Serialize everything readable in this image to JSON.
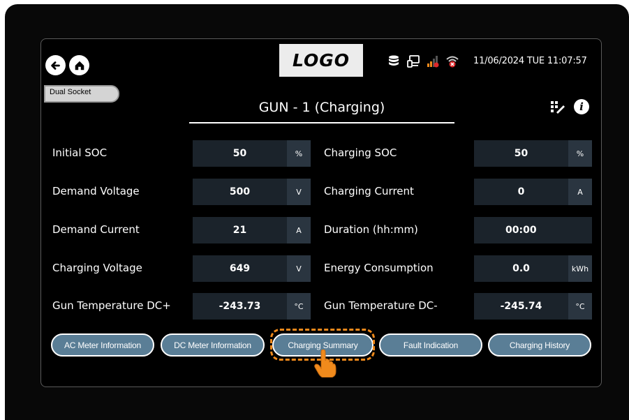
{
  "header": {
    "logo_text": "LOGO",
    "datetime": "11/06/2024 TUE 11:07:57",
    "icons": [
      "back-arrow-icon",
      "home-icon",
      "database-icon",
      "network-icon",
      "signal-bars-icon",
      "wifi-error-icon"
    ]
  },
  "mode_badge": "Dual Socket",
  "title": "GUN - 1 (Charging)",
  "left_fields": [
    {
      "label": "Initial SOC",
      "value": "50",
      "unit": "%"
    },
    {
      "label": "Demand Voltage",
      "value": "500",
      "unit": "V"
    },
    {
      "label": "Demand Current",
      "value": "21",
      "unit": "A"
    },
    {
      "label": "Charging Voltage",
      "value": "649",
      "unit": "V"
    },
    {
      "label": "Gun Temperature DC+",
      "value": "-243.73",
      "unit": "°C"
    }
  ],
  "right_fields": [
    {
      "label": "Charging SOC",
      "value": "50",
      "unit": "%"
    },
    {
      "label": "Charging Current",
      "value": "0",
      "unit": "A"
    },
    {
      "label": "Duration (hh:mm)",
      "value": "00:00",
      "unit": ""
    },
    {
      "label": "Energy Consumption",
      "value": "0.0",
      "unit": "kWh"
    },
    {
      "label": "Gun Temperature DC-",
      "value": "-245.74",
      "unit": "°C"
    }
  ],
  "buttons": [
    "AC Meter Information",
    "DC Meter Information",
    "Charging Summary",
    "Fault Indication",
    "Charging History"
  ],
  "colors": {
    "value_bg": "#1b232b",
    "unit_bg": "#2a3540",
    "pill_bg": "#5a7e96",
    "highlight": "#f08a1c",
    "wifi_error": "#e0282a",
    "signal_bar": "#f08a1c"
  }
}
